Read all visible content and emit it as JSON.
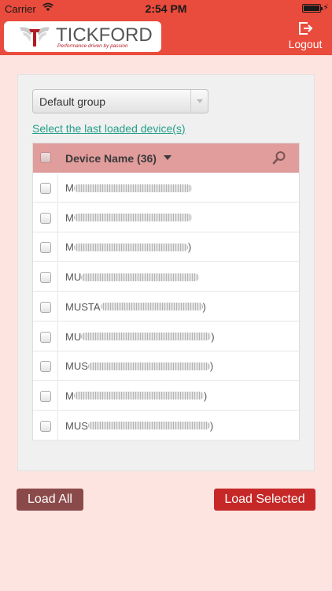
{
  "status_bar": {
    "carrier": "Carrier",
    "time": "2:54 PM"
  },
  "header": {
    "brand": "TICKFORD",
    "tagline": "Performance driven by passion",
    "logout_label": "Logout",
    "color": "#e94b3c"
  },
  "panel": {
    "group_select": {
      "value": "Default group"
    },
    "last_loaded_link": "Select the last loaded device(s)",
    "table": {
      "column_title": "Device Name (36)",
      "rows": [
        {
          "prefix": "M",
          "suffix": ""
        },
        {
          "prefix": "M",
          "suffix": ""
        },
        {
          "prefix": "M",
          "suffix": ")"
        },
        {
          "prefix": "MU",
          "suffix": ""
        },
        {
          "prefix": "MUSTA",
          "suffix": ")"
        },
        {
          "prefix": "MU",
          "suffix": ")"
        },
        {
          "prefix": "MUS",
          "suffix": ")"
        },
        {
          "prefix": "M",
          "suffix": ")"
        },
        {
          "prefix": "MUS",
          "suffix": ")"
        }
      ]
    }
  },
  "buttons": {
    "load_all": "Load All",
    "load_selected": "Load Selected"
  },
  "colors": {
    "accent": "#e94b3c",
    "background": "#fde4e0",
    "link": "#23a08a",
    "load_all": "#8b4a4a",
    "load_selected": "#c62828"
  }
}
